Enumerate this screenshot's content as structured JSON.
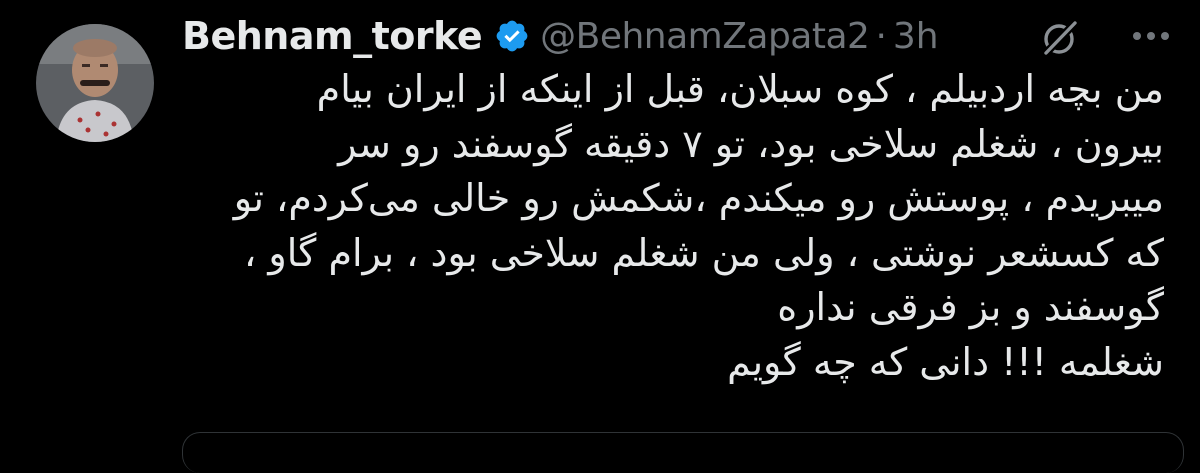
{
  "tweet": {
    "author": {
      "display_name": "Behnam_torke",
      "handle": "@BehnamZapata2",
      "verified": true,
      "avatar_icon": "profile-photo"
    },
    "separator": "·",
    "time": "3h",
    "icons": {
      "grok": "grok-icon",
      "more": "more-icon",
      "verified": "verified-badge-icon"
    },
    "body_lines": [
      "من بچه اردبیلم ، کوه سبلان، قبل از اینکه از ایران بیام",
      "بیرون ، شغلم سلاخی بود، تو ۷ دقیقه گوسفند رو سر",
      "میبریدم ، پوستش رو میکندم ،شکمش رو خالی می‌کردم، تو",
      "که کسشعر نوشتی ، ولی من شغلم سلاخی بود ، برام گاو ،",
      "گوسفند و بز فرقی نداره",
      "شغلمه !!! دانی که چه گویم"
    ]
  },
  "colors": {
    "background": "#000000",
    "text_primary": "#e7e9ea",
    "text_secondary": "#71767b",
    "verified_blue": "#1d9bf0",
    "border": "#2f3336"
  }
}
